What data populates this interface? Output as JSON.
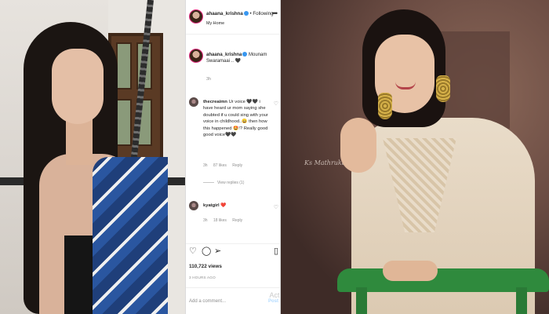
{
  "post": {
    "username": "ahaana_krishna",
    "follow_label": "Following",
    "location": "My Home",
    "more_icon": "more-dots-icon"
  },
  "caption": {
    "username": "ahaana_krishna",
    "text": "Mounam Swaramaai .. 🖤",
    "time": "3h"
  },
  "comments": [
    {
      "username": "thecreaimn",
      "text": "Ur voice 🖤🖤 i have heard ur mom saying she doubted if u could sing with your voice in childhood..😄 then how this happened 🤩!? Really good good voice🖤🖤",
      "time": "3h",
      "likes": "87 likes",
      "reply": "Reply",
      "view_replies": "View replies (1)"
    },
    {
      "username": "kyatgirl",
      "text": "❤️",
      "time": "3h",
      "likes": "18 likes",
      "reply": "Reply"
    }
  ],
  "stats": {
    "views": "110,722 views",
    "posted": "3 HOURS AGO"
  },
  "add_comment": {
    "placeholder": "Add a comment...",
    "post_label": "Post",
    "watermark": "Activ"
  },
  "photo_right": {
    "signature": "Ks Mathrukalu"
  },
  "colors": {
    "accent": "#3897f0",
    "text": "#262626",
    "muted": "#8e8e8e",
    "chair": "#2f8a3d"
  }
}
